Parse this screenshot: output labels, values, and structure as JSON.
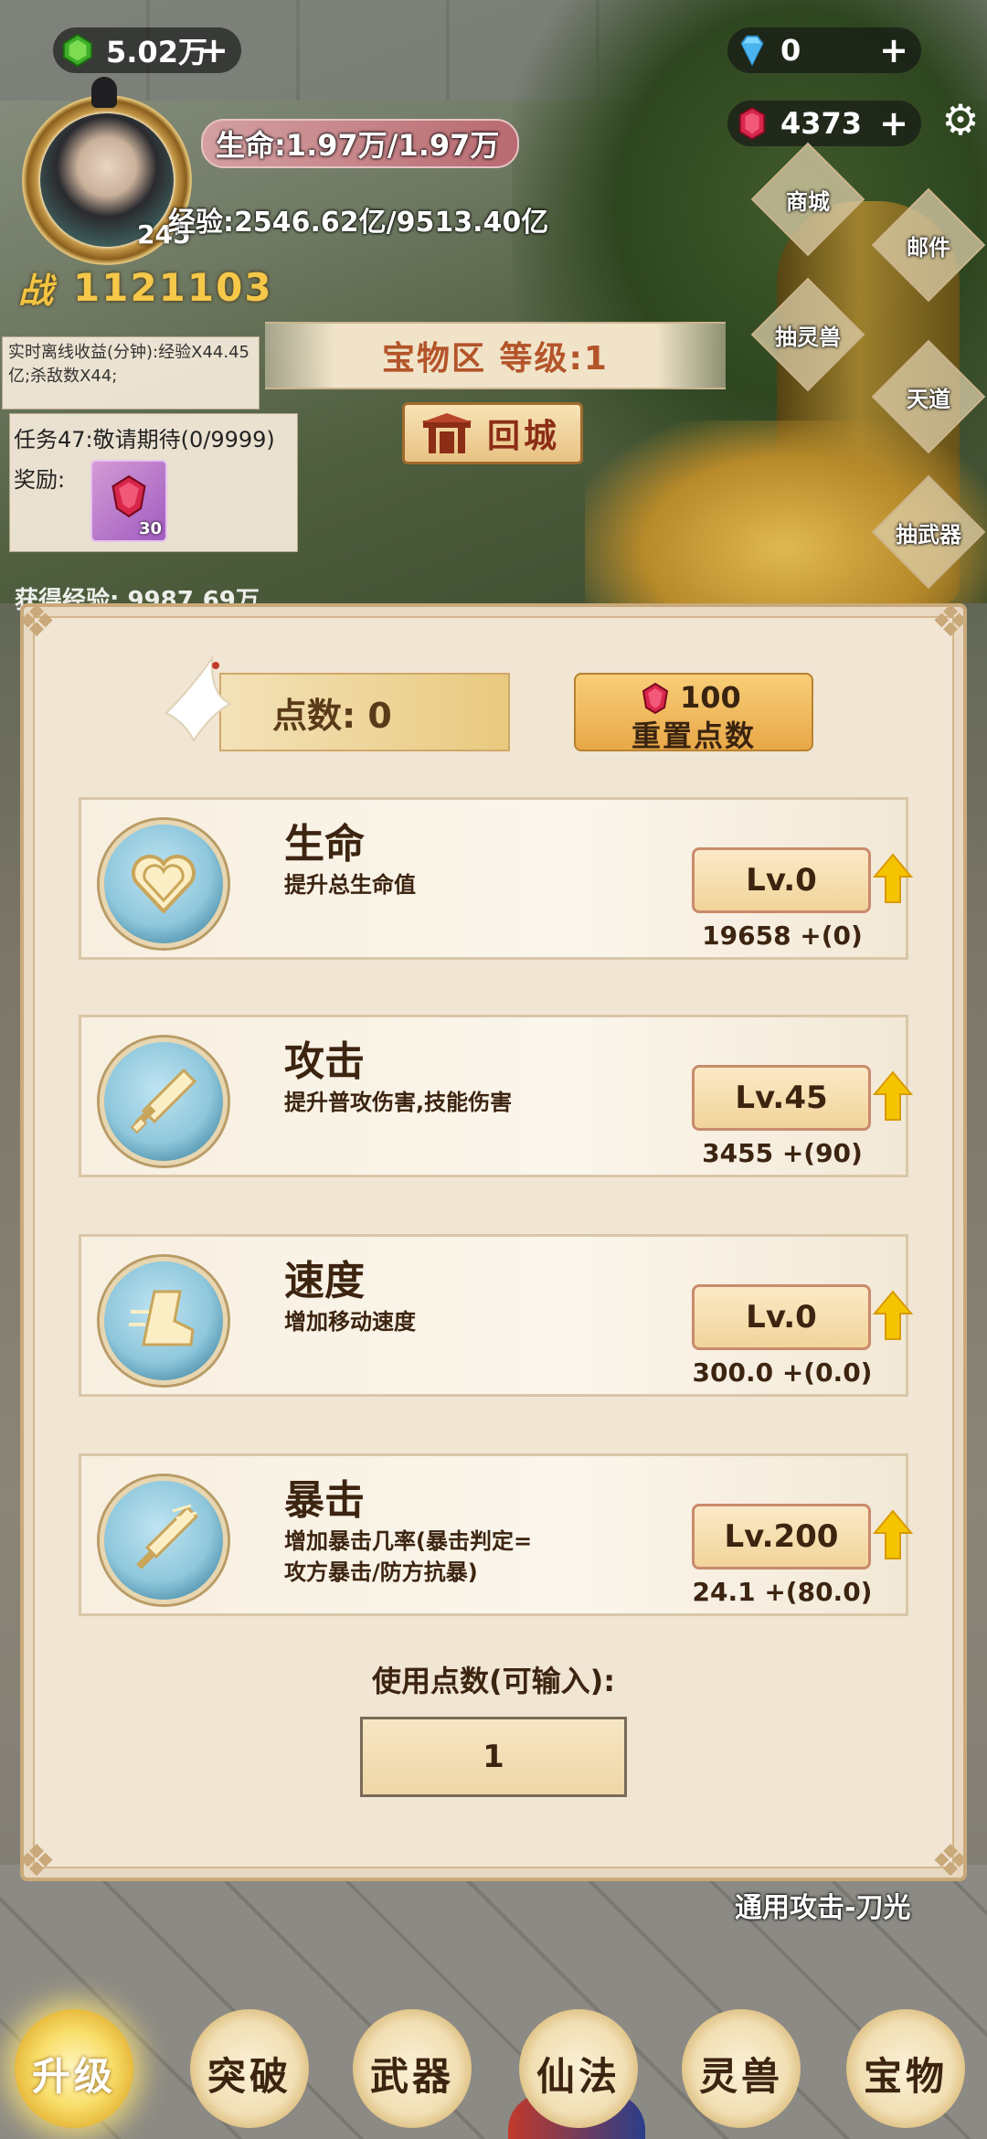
{
  "top_bar": {
    "green_currency": "5.02万",
    "diamond_currency": "0",
    "gem_currency": "4373",
    "plus": "+"
  },
  "player": {
    "level": "245",
    "hp": "生命:1.97万/1.97万",
    "exp": "经验:2546.62亿/9513.40亿",
    "power_label": "战",
    "power_value": "1121103"
  },
  "offline_info": "实时离线收益(分钟):经验X44.45亿;杀敌数X44;",
  "quest": {
    "title": "任务47:敬请期待(0/9999)",
    "reward_label": "奖励:",
    "reward_count": "30"
  },
  "zone": {
    "banner": "宝物区 等级:1",
    "home_button": "回城"
  },
  "right_menu": [
    "商城",
    "邮件",
    "抽灵兽",
    "天道",
    "抽武器"
  ],
  "obscured_text": "获得经验: 9987.69万",
  "panel": {
    "points_label": "点数: 0",
    "reset_cost": "100",
    "reset_label": "重置点数",
    "stats": [
      {
        "name": "生命",
        "desc": "提升总生命值",
        "level": "Lv.0",
        "value": "19658 +(0)",
        "icon": "heart-icon"
      },
      {
        "name": "攻击",
        "desc": "提升普攻伤害,技能伤害",
        "level": "Lv.45",
        "value": "3455 +(90)",
        "icon": "sword-icon"
      },
      {
        "name": "速度",
        "desc": "增加移动速度",
        "level": "Lv.0",
        "value": "300.0 +(0.0)",
        "icon": "boot-icon"
      },
      {
        "name": "暴击",
        "desc": "增加暴击几率(暴击判定=\n攻方暴击/防方抗暴)",
        "level": "Lv.200",
        "value": "24.1 +(80.0)",
        "icon": "critical-sword-icon"
      }
    ],
    "use_points_label": "使用点数(可输入):",
    "use_points_value": "1"
  },
  "skill_caption": "通用攻击-刀光",
  "bottom_nav": [
    {
      "label": "升级",
      "active": true
    },
    {
      "label": "突破",
      "active": false
    },
    {
      "label": "武器",
      "active": false
    },
    {
      "label": "仙法",
      "active": false
    },
    {
      "label": "灵兽",
      "active": false
    },
    {
      "label": "宝物",
      "active": false
    }
  ],
  "colors": {
    "accent_gold": "#f6c84a",
    "zone_text": "#b4542a",
    "panel_bg": "#f1e5d4",
    "text_brown": "#3c2410",
    "arrow_yellow": "#f5c400"
  }
}
